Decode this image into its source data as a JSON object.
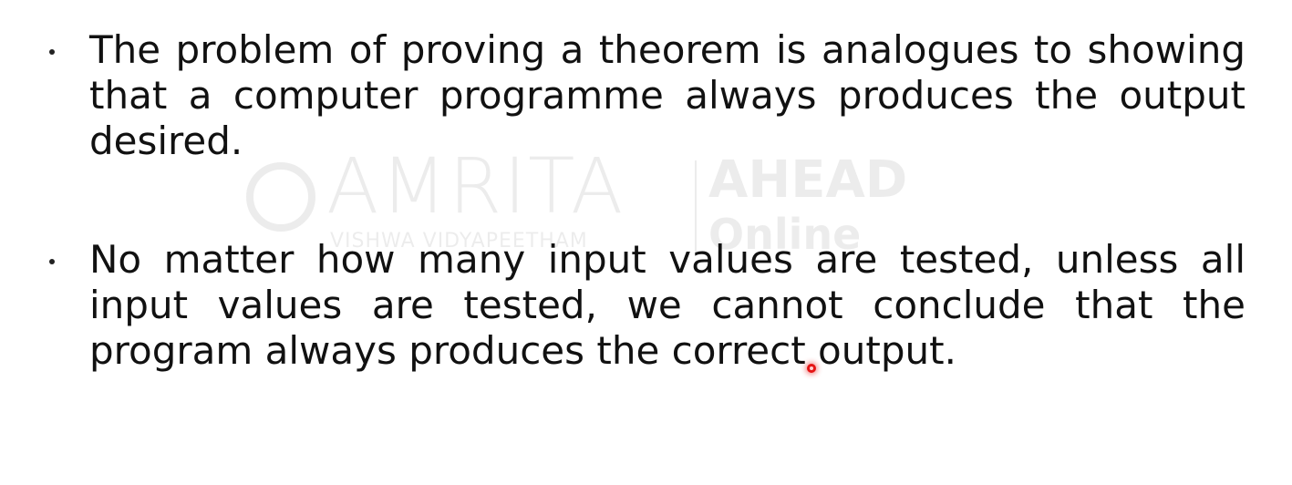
{
  "watermark": {
    "brand": "AMRITA",
    "subtitle": "VISHWA VIDYAPEETHAM",
    "partner_line1": "AHEAD",
    "partner_line2": "Online"
  },
  "bullets": [
    {
      "text": "The problem of proving a theorem is analogues to showing that a computer programme always produces the output desired."
    },
    {
      "text": "No matter how many input values are tested, unless all input values are tested, we cannot conclude that the program always produces the correct output."
    }
  ],
  "colors": {
    "background": "#ffffff",
    "text": "#111111",
    "laser_pointer": "#e51414"
  },
  "icons": {
    "bullet": "bullet-dot-icon",
    "pointer": "laser-pointer-icon"
  }
}
